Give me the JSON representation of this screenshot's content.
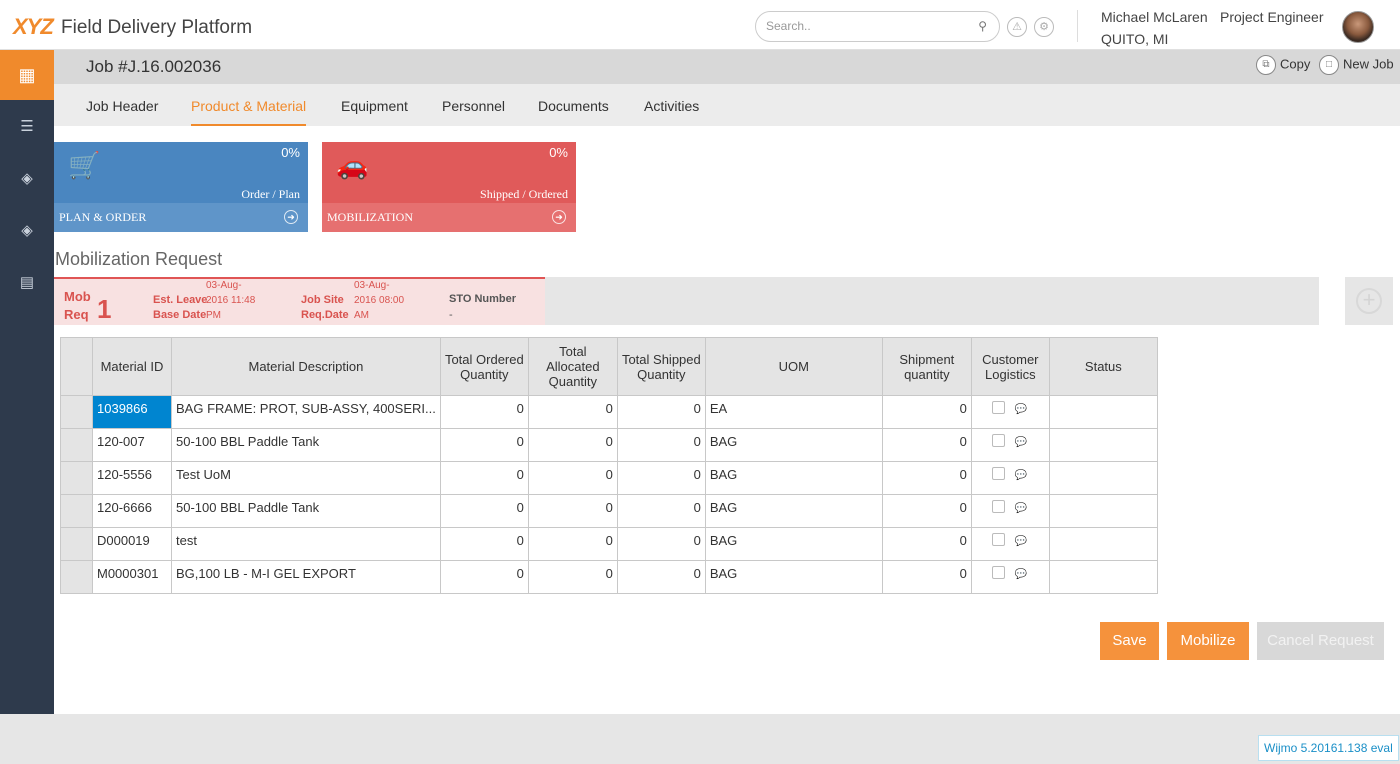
{
  "app": {
    "logo": "XYZ",
    "title": "Field Delivery Platform"
  },
  "search": {
    "placeholder": "Search.."
  },
  "user": {
    "name": "Michael McLaren",
    "role": "Project Engineer",
    "location": "QUITO, MI"
  },
  "sidebar": {
    "items": [
      {
        "icon": "grid-icon"
      },
      {
        "icon": "bar-chart-icon"
      },
      {
        "icon": "stack-icon"
      },
      {
        "icon": "stack-icon"
      },
      {
        "icon": "clipboard-icon"
      }
    ]
  },
  "job": {
    "title": "Job #J.16.002036",
    "copy_label": "Copy",
    "new_label": "New Job"
  },
  "tabs": [
    {
      "label": "Job Header"
    },
    {
      "label": "Product & Material",
      "active": true
    },
    {
      "label": "Equipment"
    },
    {
      "label": "Personnel"
    },
    {
      "label": "Documents"
    },
    {
      "label": "Activities"
    }
  ],
  "cards": [
    {
      "percent": "0%",
      "caption": "Order / Plan",
      "footer": "PLAN & ORDER",
      "color": "#4a86c0",
      "icon": "cart-icon"
    },
    {
      "percent": "0%",
      "caption": "Shipped / Ordered",
      "footer": "MOBILIZATION",
      "color": "#e05a5a",
      "icon": "car-icon"
    }
  ],
  "section": {
    "title": "Mobilization Request"
  },
  "mob": {
    "label1": "Mob",
    "label2": "Req",
    "number": "1",
    "est_leave_k1": "Est. Leave",
    "est_leave_k2": "Base Date",
    "est_leave_v1": "03-Aug-",
    "est_leave_v2": "2016 11:48",
    "est_leave_v3": "PM",
    "job_site_k1": "Job Site",
    "job_site_k2": "Req.Date",
    "job_site_v1": "03-Aug-",
    "job_site_v2": "2016 08:00",
    "job_site_v3": "AM",
    "sto_label": "STO Number",
    "sto_value": "-"
  },
  "table": {
    "headers": [
      "Material ID",
      "Material Description",
      "Total Ordered Quantity",
      "Total Allocated Quantity",
      "Total Shipped Quantity",
      "UOM",
      "Shipment quantity",
      "Customer Logistics",
      "Status"
    ],
    "rows": [
      {
        "id": "1039866",
        "desc": "BAG FRAME: PROT, SUB-ASSY, 400SERI...",
        "ordered": "0",
        "allocated": "0",
        "shipped": "0",
        "uom": "EA",
        "shipment": "0",
        "status": ""
      },
      {
        "id": "120-007",
        "desc": "50-100 BBL Paddle Tank",
        "ordered": "0",
        "allocated": "0",
        "shipped": "0",
        "uom": "BAG",
        "shipment": "0",
        "status": ""
      },
      {
        "id": "120-5556",
        "desc": "Test UoM",
        "ordered": "0",
        "allocated": "0",
        "shipped": "0",
        "uom": "BAG",
        "shipment": "0",
        "status": ""
      },
      {
        "id": "120-6666",
        "desc": "50-100 BBL Paddle Tank",
        "ordered": "0",
        "allocated": "0",
        "shipped": "0",
        "uom": "BAG",
        "shipment": "0",
        "status": ""
      },
      {
        "id": "D000019",
        "desc": "test",
        "ordered": "0",
        "allocated": "0",
        "shipped": "0",
        "uom": "BAG",
        "shipment": "0",
        "status": ""
      },
      {
        "id": "M0000301",
        "desc": "BG,100 LB - M-I GEL EXPORT",
        "ordered": "0",
        "allocated": "0",
        "shipped": "0",
        "uom": "BAG",
        "shipment": "0",
        "status": ""
      }
    ]
  },
  "buttons": {
    "save": "Save",
    "mobilize": "Mobilize",
    "cancel": "Cancel Request"
  },
  "colors": {
    "accent": "#f08a2c",
    "sidebar": "#2e3a4c",
    "selected": "#0085d0"
  },
  "footer": {
    "wijmo": "Wijmo 5.20161.138 eval"
  }
}
